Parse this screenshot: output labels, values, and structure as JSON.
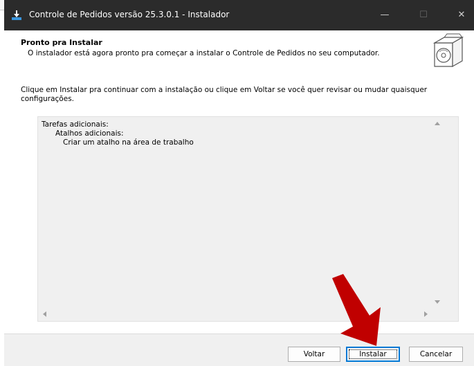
{
  "window": {
    "title": "Controle de Pedidos versão 25.3.0.1 - Instalador",
    "minimize": "—",
    "maximize": "☐",
    "close": "✕"
  },
  "header": {
    "title": "Pronto pra Instalar",
    "subtitle": "O instalador está agora pronto pra começar a instalar o Controle de Pedidos no seu computador."
  },
  "instructions": "Clique em Instalar pra continuar com a instalação ou clique em Voltar se você quer revisar ou mudar quaisquer configurações.",
  "memo": {
    "lines": [
      "Tarefas adicionais:",
      "Atalhos adicionais:",
      "Criar um atalho na área de trabalho"
    ]
  },
  "buttons": {
    "back": "Voltar",
    "install": "Instalar",
    "cancel": "Cancelar"
  },
  "colors": {
    "titlebar": "#2b2b2b",
    "accent": "#0078d4",
    "arrow": "#c00000"
  },
  "icons": [
    "install-icon",
    "software-box-icon",
    "arrow-pointer-icon"
  ]
}
